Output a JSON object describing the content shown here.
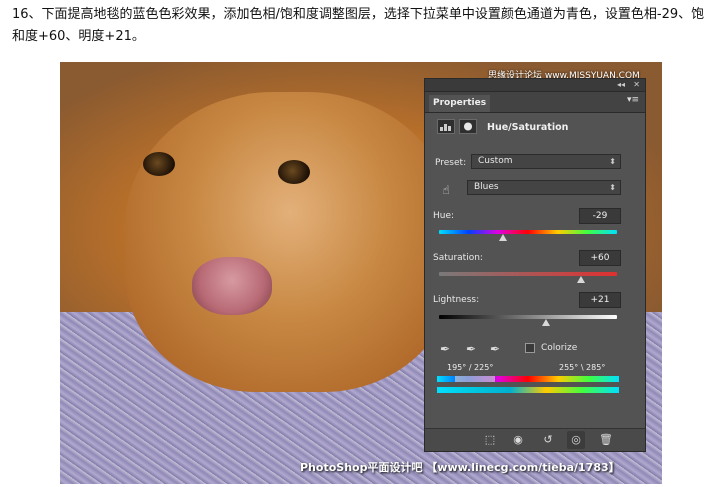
{
  "instruction": "16、下面提高地毯的蓝色色彩效果，添加色相/饱和度调整图层，选择下拉菜单中设置颜色通道为青色，设置色相-29、饱和度+60、明度+21。",
  "watermark_top": "思缘设计论坛 www.MISSYUAN.COM",
  "watermark_bottom": "PhotoShop平面设计吧 【www.linecg.com/tieba/1783】",
  "panel": {
    "collapse_glyph": "◂◂",
    "close_glyph": "✕",
    "tab_label": "Properties",
    "menu_glyph": "▾≡",
    "title": "Hue/Saturation",
    "preset_label": "Preset:",
    "preset_value": "Custom",
    "channel_value": "Blues",
    "hue": {
      "label": "Hue:",
      "value": "-29",
      "fraction": 0.36
    },
    "saturation": {
      "label": "Saturation:",
      "value": "+60",
      "fraction": 0.8
    },
    "lightness": {
      "label": "Lightness:",
      "value": "+21",
      "fraction": 0.6
    },
    "colorize_label": "Colorize",
    "colorize_checked": false,
    "range": {
      "left": "195° / 225°",
      "right": "255° \\ 285°"
    },
    "footer_icons": [
      "clip-to-layer-icon",
      "view-previous-icon",
      "reset-icon",
      "visibility-eye-icon",
      "trash-icon"
    ]
  },
  "colors": {
    "panel_bg": "#535353",
    "panel_dark": "#3a3a3a",
    "accent_saturation": "#e03030"
  }
}
